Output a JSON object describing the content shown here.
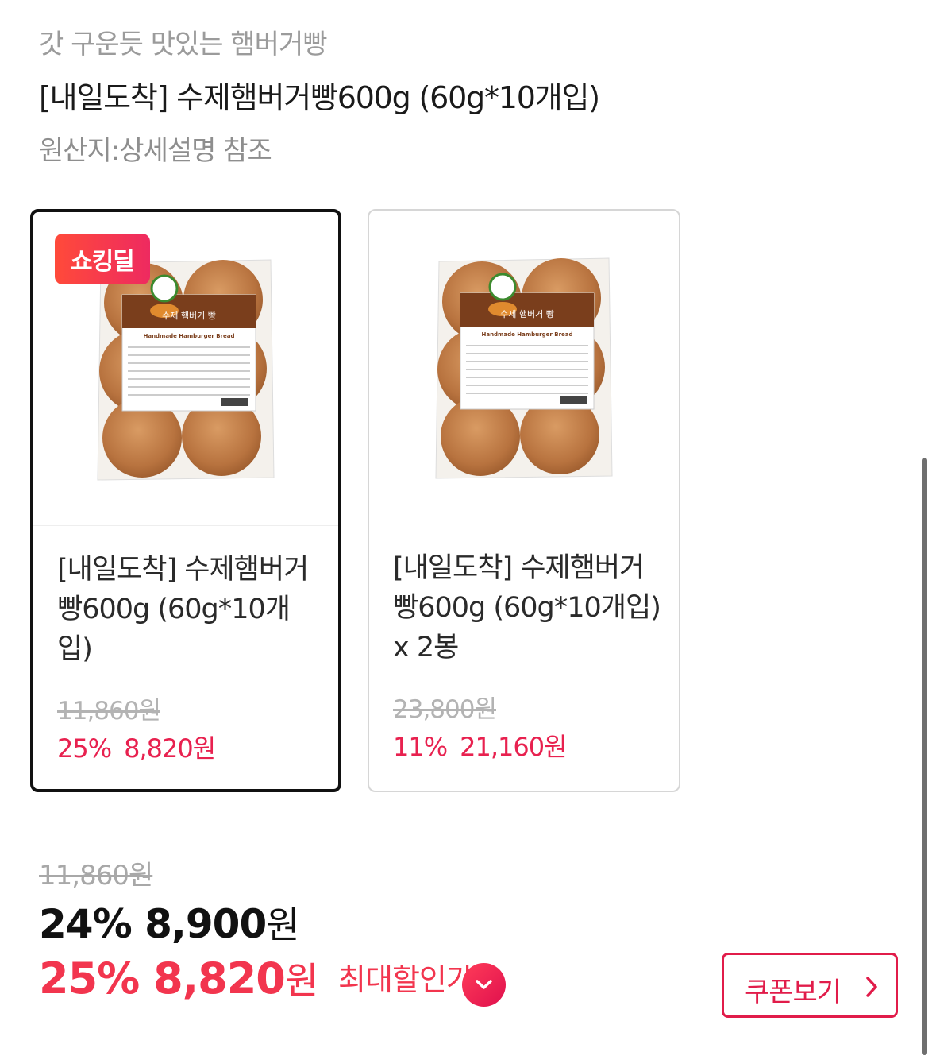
{
  "header": {
    "subtitle": "갓 구운듯 맛있는 햄버거빵",
    "title": "[내일도착] 수제햄버거빵600g (60g*10개입)",
    "origin": "원산지:상세설명 참조"
  },
  "options": [
    {
      "badge": "쇼킹딜",
      "name": "[내일도착] 수제햄버거빵600g (60g*10개입)",
      "original_price": "11,860원",
      "discount": "25%",
      "sale_price": "8,820원",
      "selected": true
    },
    {
      "name": "[내일도착] 수제햄버거빵600g (60g*10개입) x 2봉",
      "original_price": "23,800원",
      "discount": "11%",
      "sale_price": "21,160원",
      "selected": false
    }
  ],
  "package": {
    "label_title": "수제 햄버거 빵",
    "label_subtitle": "Handmade Hamburger Bread"
  },
  "price": {
    "original": "11,860원",
    "discount": "24%",
    "amount": "8,900",
    "unit": "원",
    "best_discount": "25%",
    "best_amount": "8,820",
    "best_unit": "원",
    "best_label": "최대할인가"
  },
  "coupon_button": "쿠폰보기",
  "colors": {
    "accent": "#e8214f",
    "best_price": "#f2354e",
    "selected_border": "#111111"
  },
  "icons": {
    "best_price_toggle": "chevron-down-icon",
    "coupon": "chevron-right-icon"
  }
}
